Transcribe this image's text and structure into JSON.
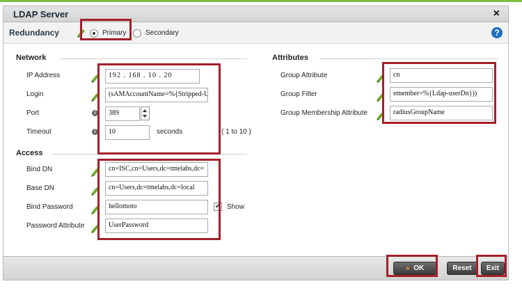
{
  "dialog": {
    "title": "LDAP Server",
    "close": "×"
  },
  "redundancy": {
    "label": "Redundancy",
    "options": [
      "Primary",
      "Secondary"
    ],
    "selected": "Primary"
  },
  "help": "?",
  "network": {
    "heading": "Network",
    "ip_label": "IP Address",
    "ip_value": "192 . 168 . 10 . 20",
    "login_label": "Login",
    "login_value": "(sAMAccountName=%{Stripped-U",
    "port_label": "Port",
    "port_value": "389",
    "timeout_label": "Timeout",
    "timeout_value": "10",
    "timeout_unit": "seconds",
    "timeout_range": "( 1 to 10 )"
  },
  "access": {
    "heading": "Access",
    "binddn_label": "Bind DN",
    "binddn_value": "cn=ISC,cn=Users,dc=tmelabs,dc=",
    "basedn_label": "Base DN",
    "basedn_value": "cn=Users,dc=tmelabs,dc=local",
    "bindpw_label": "Bind Password",
    "bindpw_value": "hellomoto",
    "show_label": "Show",
    "show_checked": true,
    "pwattr_label": "Password Attribute",
    "pwattr_value": "UserPassword"
  },
  "attributes": {
    "heading": "Attributes",
    "group_attr_label": "Group Attribute",
    "group_attr_value": "cn",
    "group_filter_label": "Group Filter",
    "group_filter_value": "emember=%{Ldap-userDn}))",
    "group_member_label": "Group Membership Attribute",
    "group_member_value": "radiusGroupName"
  },
  "footer": {
    "ok": "OK",
    "reset": "Reset",
    "exit": "Exit"
  },
  "colors": {
    "highlight": "#a3202a",
    "pencil": "#6bb02f",
    "accent_line": "#7bbf3f",
    "help": "#1e6ec4"
  }
}
